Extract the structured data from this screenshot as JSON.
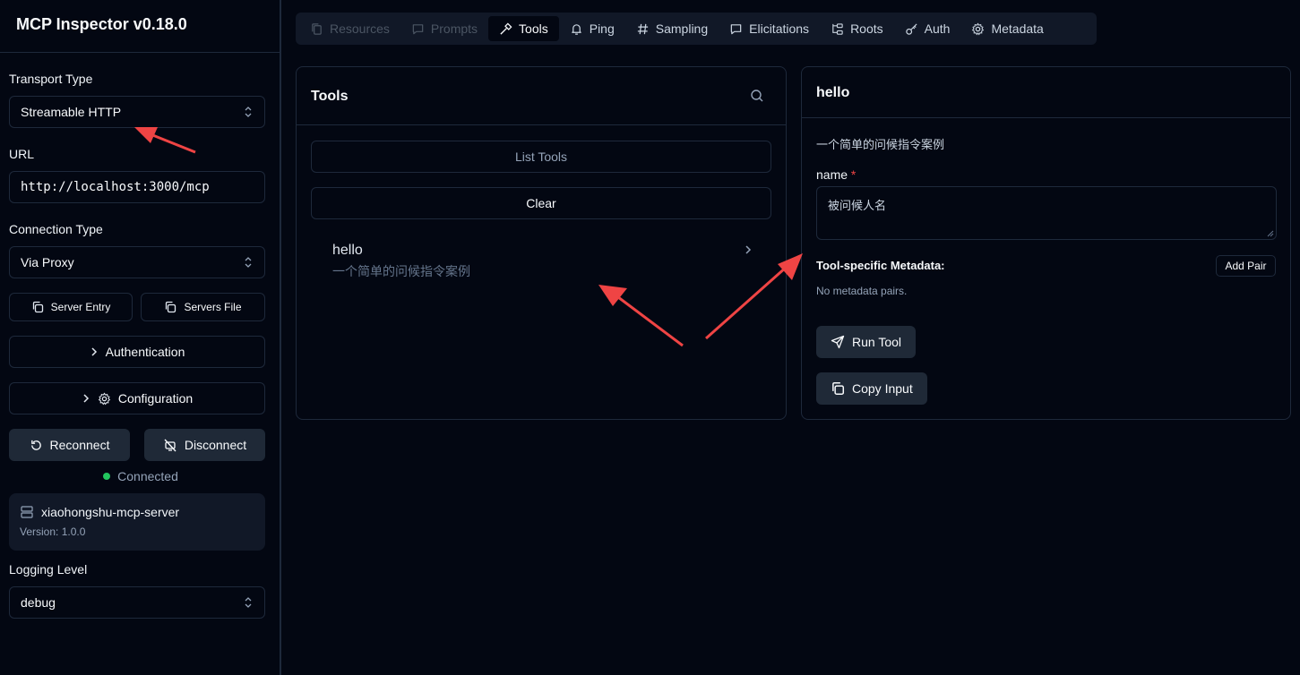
{
  "app": {
    "title": "MCP Inspector v0.18.0"
  },
  "sidebar": {
    "transport_label": "Transport Type",
    "transport_value": "Streamable HTTP",
    "url_label": "URL",
    "url_value": "http://localhost:3000/mcp",
    "connection_label": "Connection Type",
    "connection_value": "Via Proxy",
    "server_entry": "Server Entry",
    "servers_file": "Servers File",
    "authentication": "Authentication",
    "configuration": "Configuration",
    "reconnect": "Reconnect",
    "disconnect": "Disconnect",
    "status": "Connected",
    "server_name": "xiaohongshu-mcp-server",
    "server_version": "Version: 1.0.0",
    "logging_label": "Logging Level",
    "logging_value": "debug"
  },
  "tabs": [
    {
      "label": "Resources",
      "icon": "files-icon",
      "state": "disabled"
    },
    {
      "label": "Prompts",
      "icon": "message-icon",
      "state": "disabled"
    },
    {
      "label": "Tools",
      "icon": "hammer-icon",
      "state": "active"
    },
    {
      "label": "Ping",
      "icon": "bell-icon",
      "state": "normal"
    },
    {
      "label": "Sampling",
      "icon": "hash-icon",
      "state": "normal"
    },
    {
      "label": "Elicitations",
      "icon": "message-icon",
      "state": "normal"
    },
    {
      "label": "Roots",
      "icon": "folder-tree-icon",
      "state": "normal"
    },
    {
      "label": "Auth",
      "icon": "key-icon",
      "state": "normal"
    },
    {
      "label": "Metadata",
      "icon": "gear-icon",
      "state": "normal"
    }
  ],
  "tools_panel": {
    "title": "Tools",
    "list_button": "List Tools",
    "clear_button": "Clear",
    "tools": [
      {
        "name": "hello",
        "description": "一个简单的问候指令案例"
      }
    ]
  },
  "detail_panel": {
    "title": "hello",
    "description": "一个简单的问候指令案例",
    "arg_name": "name",
    "arg_required": "*",
    "arg_placeholder": "被问候人名",
    "meta_label": "Tool-specific Metadata:",
    "add_pair": "Add Pair",
    "meta_empty": "No metadata pairs.",
    "run_button": "Run Tool",
    "copy_button": "Copy Input"
  },
  "colors": {
    "background": "#030712",
    "border": "#1e293b",
    "status_dot": "#22c55e",
    "annotation_arrow": "#ef4444",
    "required": "#ef4444"
  }
}
